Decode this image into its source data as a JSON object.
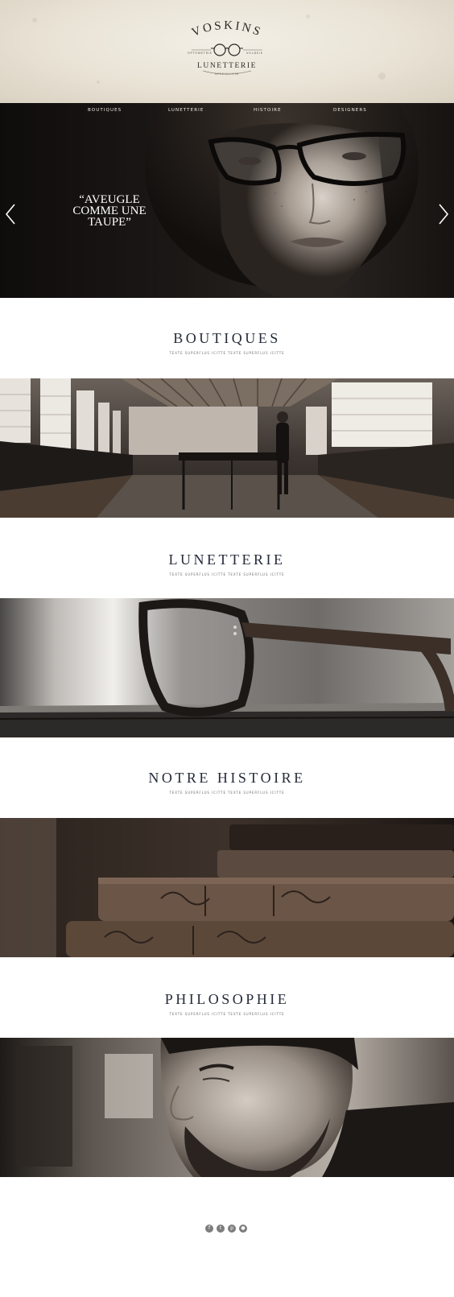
{
  "brand": {
    "name": "VOSKINS",
    "left_caption": "OPTOMETRIE",
    "right_caption": "VOLDEIS",
    "tagline": "LUNETTERIE",
    "sub": "SPECIALISTE"
  },
  "nav": {
    "items": [
      {
        "label": "BOUTIQUES"
      },
      {
        "label": "LUNETTERIE"
      },
      {
        "label": "HISTOIRE"
      },
      {
        "label": "DESIGNERS"
      }
    ]
  },
  "hero": {
    "quote": "“AVEUGLE COMME UNE TAUPE”",
    "prev_icon": "chevron-left-icon",
    "next_icon": "chevron-right-icon"
  },
  "sections": {
    "boutiques": {
      "title": "BOUTIQUES",
      "subtitle": "TEXTE SUPERFLUS ICITTE TEXTE SUPERFLUS ICITTE"
    },
    "lunetterie": {
      "title": "LUNETTERIE",
      "subtitle": "TEXTE SUPERFLUS ICITTE TEXTE SUPERFLUS ICITTE"
    },
    "histoire": {
      "title": "NOTRE HISTOIRE",
      "subtitle": "TEXTE SUPERFLUS ICITTE TEXTE SUPERFLUS ICITTE"
    },
    "philosophie": {
      "title": "PHILOSOPHIE",
      "subtitle": "TEXTE SUPERFLUS ICITTE TEXTE SUPERFLUS ICITTE"
    }
  },
  "social": {
    "items": [
      {
        "icon": "facebook-icon",
        "glyph": "f"
      },
      {
        "icon": "twitter-icon",
        "glyph": "t"
      },
      {
        "icon": "pinterest-icon",
        "glyph": "p"
      },
      {
        "icon": "instagram-icon",
        "glyph": "●"
      }
    ]
  },
  "colors": {
    "title_navy": "#262b3a",
    "paper": "#ece6da",
    "dark": "#1b1816",
    "sepia": "#6b4f3d"
  }
}
